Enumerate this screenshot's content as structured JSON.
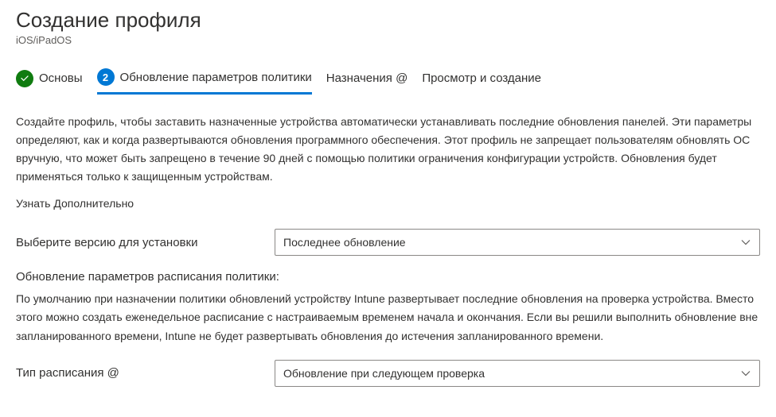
{
  "header": {
    "title": "Создание профиля",
    "subtitle": "iOS/iPadOS"
  },
  "stepper": {
    "steps": [
      {
        "label": "Основы",
        "state": "done"
      },
      {
        "label": "Обновление параметров политики",
        "number": "2",
        "state": "current"
      },
      {
        "label": "Назначения @",
        "state": "pending"
      },
      {
        "label": "Просмотр и создание",
        "state": "pending"
      }
    ]
  },
  "description": "Создайте профиль, чтобы заставить назначенные устройства автоматически устанавливать последние обновления панелей. Эти параметры определяют, как и когда развертываются обновления программного обеспечения. Этот профиль не запрещает пользователям обновлять ОС вручную, что может быть запрещено в течение 90 дней с помощью политики ограничения конфигурации устройств. Обновления будет применяться только к защищенным устройствам.",
  "learnMore": "Узнать Дополнительно",
  "fields": {
    "versionLabel": "Выберите версию для установки",
    "versionValue": "Последнее обновление",
    "scheduleHeading": "Обновление параметров расписания политики:",
    "scheduleDescription": "По умолчанию при назначении политики обновлений устройству Intune развертывает последние обновления на проверка устройства. Вместо этого можно создать еженедельное расписание с настраиваемым временем начала и окончания. Если вы решили выполнить обновление вне запланированного времени, Intune не будет развертывать обновления до истечения запланированного времени.",
    "scheduleTypeLabel": "Тип расписания @",
    "scheduleTypeValue": "Обновление при следующем проверка"
  }
}
